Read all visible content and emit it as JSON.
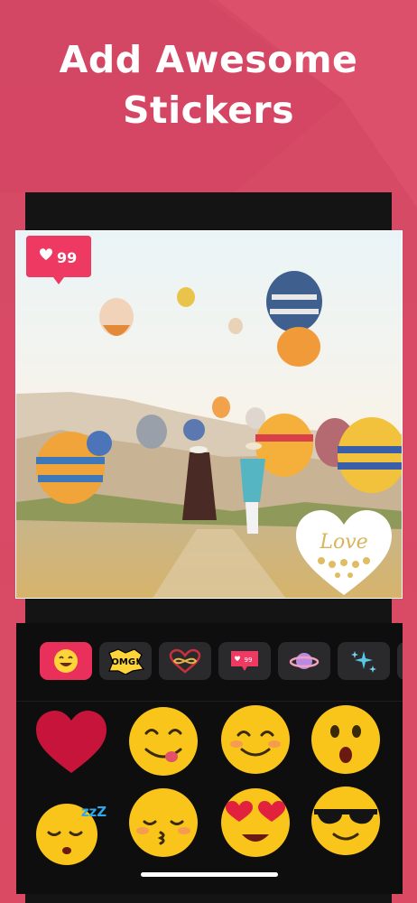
{
  "headline": {
    "line1": "Add Awesome",
    "line2": "Stickers"
  },
  "colors": {
    "background": "#d84866",
    "accent": "#e8305a",
    "editor_bg": "#0e0e0e",
    "tab_bg": "#2a2a2c"
  },
  "like_sticker": {
    "icon": "heart-icon",
    "count": "99"
  },
  "love_sticker": {
    "text": "Love"
  },
  "sticker_tabs": [
    {
      "icon": "smiley-icon",
      "selected": true
    },
    {
      "icon": "omg-icon",
      "label": "OMG!",
      "selected": false
    },
    {
      "icon": "infinity-heart-icon",
      "selected": false
    },
    {
      "icon": "like-count-icon",
      "label": "99",
      "selected": false
    },
    {
      "icon": "planet-icon",
      "selected": false
    },
    {
      "icon": "sparkles-icon",
      "selected": false
    }
  ],
  "stickers": [
    {
      "icon": "red-heart-icon"
    },
    {
      "icon": "yummy-face-icon"
    },
    {
      "icon": "smiling-face-icon"
    },
    {
      "icon": "surprised-face-icon"
    },
    {
      "icon": "sleeping-face-icon",
      "label": "zzZ"
    },
    {
      "icon": "kissing-face-icon"
    },
    {
      "icon": "heart-eyes-face-icon"
    },
    {
      "icon": "sunglasses-face-icon"
    }
  ]
}
